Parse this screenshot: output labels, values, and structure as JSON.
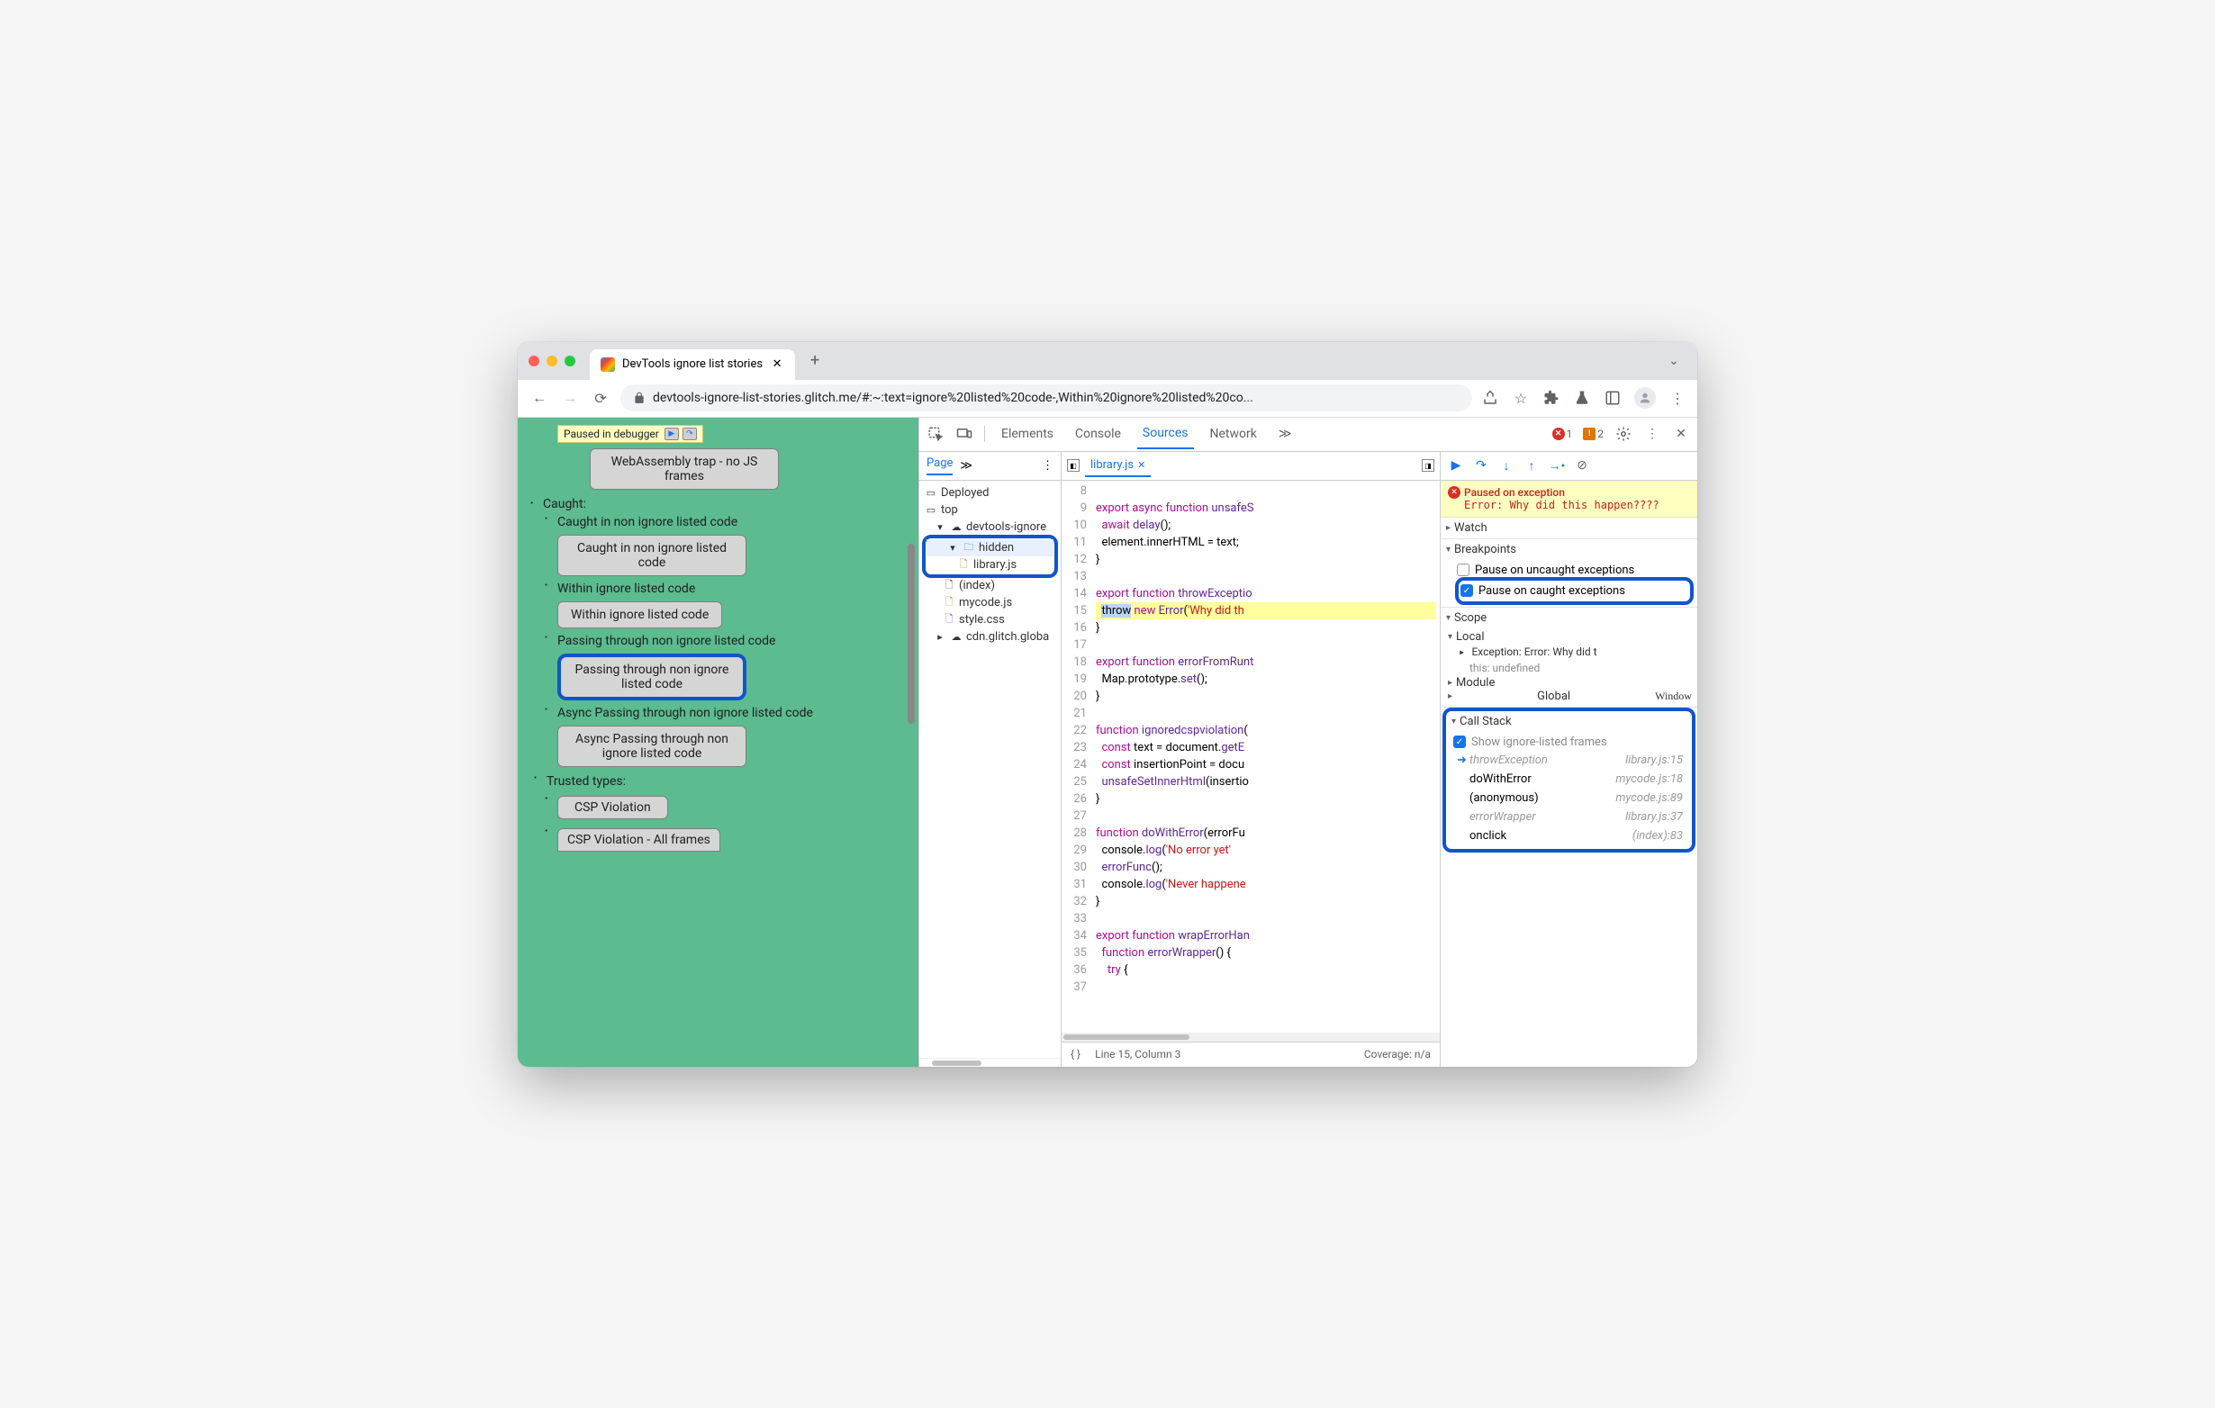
{
  "browser": {
    "tab_title": "DevTools ignore list stories",
    "url": "devtools-ignore-list-stories.glitch.me/#:~:text=ignore%20listed%20code-,Within%20ignore%20listed%20co...",
    "paused_banner": "Paused in debugger"
  },
  "page": {
    "caught_label": "Caught:",
    "items": [
      {
        "text": "WebAssembly trap - no JS frames",
        "button": true
      },
      {
        "text": "Caught in non ignore listed code"
      },
      {
        "text": "Caught in non ignore listed code",
        "button": true
      },
      {
        "text": "Within ignore listed code"
      },
      {
        "text": "Within ignore listed code",
        "button": true
      },
      {
        "text": "Passing through non ignore listed code"
      },
      {
        "text": "Passing through non ignore listed code",
        "button": true,
        "highlight": true
      },
      {
        "text": "Async Passing through non ignore listed code"
      },
      {
        "text": "Async Passing through non ignore listed code",
        "button": true
      }
    ],
    "trusted_types_label": "Trusted types:",
    "trusted_items": [
      "CSP Violation",
      "CSP Violation - All frames"
    ]
  },
  "devtools": {
    "tabs": [
      "Elements",
      "Console",
      "Sources",
      "Network"
    ],
    "active_tab": "Sources",
    "error_count": "1",
    "warning_count": "2",
    "nav": {
      "page_tab": "Page",
      "deployed": "Deployed",
      "top": "top",
      "origin": "devtools-ignore",
      "hidden_folder": "hidden",
      "library_file": "library.js",
      "index_file": "(index)",
      "mycode_file": "mycode.js",
      "style_file": "style.css",
      "cdn_origin": "cdn.glitch.globa"
    },
    "editor": {
      "filename": "library.js",
      "lines": [
        "8",
        "9",
        "10",
        "11",
        "12",
        "13",
        "14",
        "15",
        "16",
        "17",
        "18",
        "19",
        "20",
        "21",
        "22",
        "23",
        "24",
        "25",
        "26",
        "27",
        "28",
        "29",
        "30",
        "31",
        "32",
        "33",
        "34",
        "35",
        "36",
        "37"
      ],
      "status_line": "Line 15, Column 3",
      "coverage": "Coverage: n/a"
    },
    "code": {
      "l8": "export async function unsafeS",
      "l9": "  await delay();",
      "l10": "  element.innerHTML = text;",
      "l11": "}",
      "l14": "export function throwExceptio",
      "l15a": "  throw",
      "l15b": " new ",
      "l15c": "Error",
      "l15d": "('Why did th",
      "l16": "}",
      "l18": "export function errorFromRunt",
      "l19": "  Map.prototype.set();",
      "l20": "}",
      "l22": "function ignoredcspviolation(",
      "l23": "  const text = document.getE",
      "l24": "  const insertionPoint = docu",
      "l25": "  unsafeSetInnerHtml(insertio",
      "l26": "}",
      "l28": "function doWithError(errorFu",
      "l29": "  console.log('No error yet'",
      "l30": "  errorFunc();",
      "l31": "  console.log('Never happene",
      "l32": "}",
      "l34": "export function wrapErrorHan",
      "l35": "  function errorWrapper() {",
      "l36": "    try {"
    },
    "debugger": {
      "paused_title": "Paused on exception",
      "paused_error": "Error: Why did this happen????",
      "watch": "Watch",
      "breakpoints": "Breakpoints",
      "bp_uncaught": "Pause on uncaught exceptions",
      "bp_caught": "Pause on caught exceptions",
      "scope": "Scope",
      "scope_local": "Local",
      "scope_exception": "Exception: Error: Why did t",
      "scope_this": "this: undefined",
      "scope_module": "Module",
      "scope_global": "Global",
      "scope_global_val": "Window",
      "callstack": "Call Stack",
      "show_ignored": "Show ignore-listed frames",
      "frames": [
        {
          "name": "throwException",
          "loc": "library.js:15",
          "ignored": true,
          "current": true
        },
        {
          "name": "doWithError",
          "loc": "mycode.js:18"
        },
        {
          "name": "(anonymous)",
          "loc": "mycode.js:89"
        },
        {
          "name": "errorWrapper",
          "loc": "library.js:37",
          "ignored": true
        },
        {
          "name": "onclick",
          "loc": "(index):83"
        }
      ]
    }
  }
}
